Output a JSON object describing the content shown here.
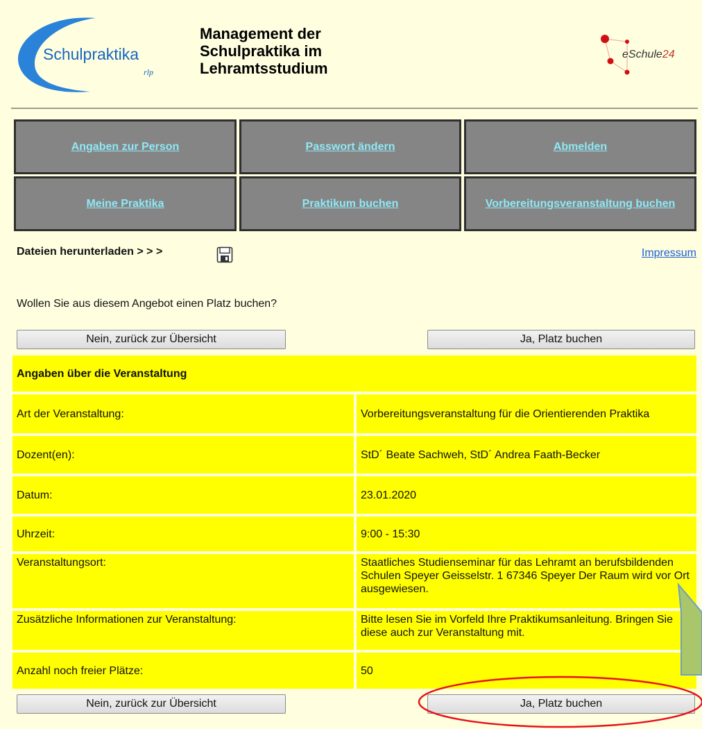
{
  "header": {
    "logo_left_text": "Schulpraktika",
    "logo_left_sub": "rlp",
    "title_lines": [
      "Management der",
      "Schulpraktika im",
      "Lehramtsstudium"
    ],
    "logo_right_text": "eSchule",
    "logo_right_num": "24"
  },
  "nav": {
    "row1": [
      "Angaben zur Person",
      "Passwort ändern",
      "Abmelden"
    ],
    "row2": [
      "Meine Praktika",
      "Praktikum buchen",
      "Vorbereitungsveranstaltung buchen"
    ]
  },
  "toolbar": {
    "downloads_label": "Dateien herunterladen > > >",
    "save_icon": "floppy-disk-icon",
    "impressum_label": "Impressum"
  },
  "question": "Wollen Sie aus diesem Angebot einen Platz buchen?",
  "buttons": {
    "no_label": "Nein, zurück zur Übersicht",
    "yes_label": "Ja, Platz buchen"
  },
  "details": {
    "heading": "Angaben über die Veranstaltung",
    "rows": [
      {
        "label": "Art der Veranstaltung:",
        "value": "Vorbereitungsveranstaltung für die Orientierenden Praktika"
      },
      {
        "label": "Dozent(en):",
        "value": "StD´ Beate Sachweh, StD´ Andrea Faath-Becker"
      },
      {
        "label": "Datum:",
        "value": "23.01.2020"
      },
      {
        "label": "Uhrzeit:",
        "value": "9:00 - 15:30"
      },
      {
        "label": "Veranstaltungsort:",
        "value": "Staatliches Studienseminar für das Lehramt an berufsbildenden Schulen Speyer Geisselstr. 1 67346 Speyer Der Raum wird vor Ort ausgewiesen."
      },
      {
        "label": "Zusätzliche Informationen zur Veranstaltung:",
        "value": "Bitte lesen Sie im Vorfeld Ihre Praktikumsanleitung. Bringen Sie diese auch zur Veranstaltung mit."
      },
      {
        "label": "Anzahl noch freier Plätze:",
        "value": "50"
      }
    ]
  },
  "colors": {
    "page_bg": "#ffffe0",
    "nav_bg": "#858585",
    "nav_link": "#8fe8f5",
    "table_bg": "#ffff00",
    "impressum_link": "#1a5fd6",
    "annotation_ellipse": "#e8101a",
    "annotation_arrow": "#a9c66a"
  }
}
